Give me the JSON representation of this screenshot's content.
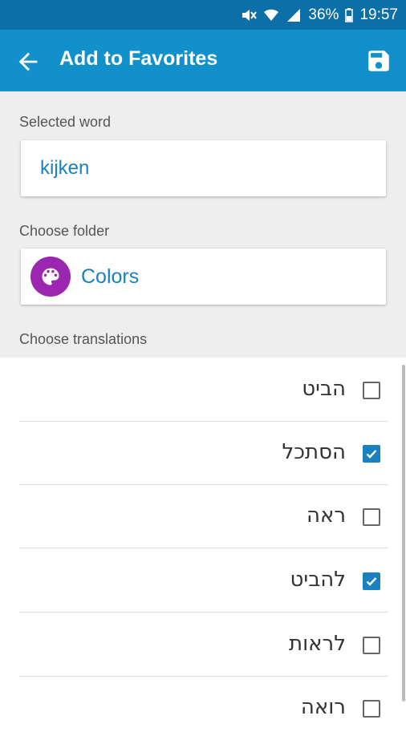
{
  "status_bar": {
    "battery": "36%",
    "time": "19:57"
  },
  "app_bar": {
    "title": "Add to Favorites"
  },
  "selected_word": {
    "label": "Selected word",
    "value": "kijken"
  },
  "folder": {
    "label": "Choose folder",
    "name": "Colors",
    "icon_color": "#9b27b0"
  },
  "translations": {
    "label": "Choose translations",
    "items": [
      {
        "text": "הביט",
        "checked": false
      },
      {
        "text": "הסתכל",
        "checked": true
      },
      {
        "text": "ראה",
        "checked": false
      },
      {
        "text": "להביט",
        "checked": true
      },
      {
        "text": "לראות",
        "checked": false
      },
      {
        "text": "רואה",
        "checked": false
      }
    ]
  },
  "colors": {
    "status_bar": "#0c6fa8",
    "app_bar": "#1190cb",
    "accent": "#1a80bf"
  }
}
